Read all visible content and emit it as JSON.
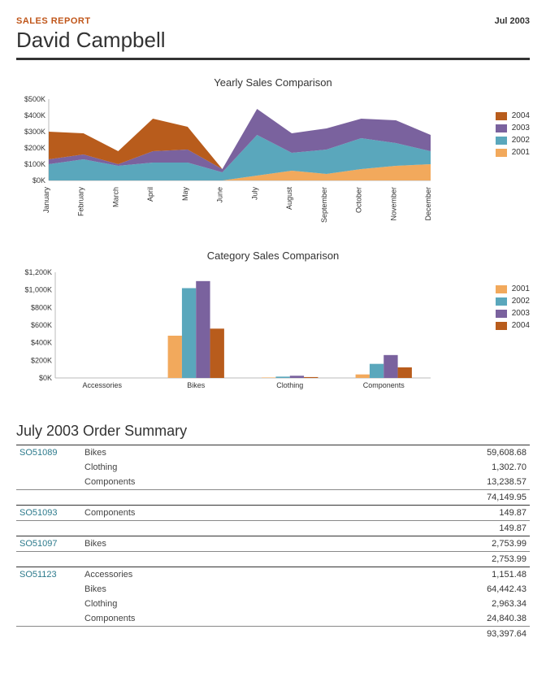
{
  "header": {
    "label": "SALES REPORT",
    "date": "Jul 2003",
    "name": "David Campbell"
  },
  "chart_data": [
    {
      "type": "area",
      "title": "Yearly Sales Comparison",
      "categories": [
        "January",
        "February",
        "March",
        "April",
        "May",
        "June",
        "July",
        "August",
        "September",
        "October",
        "November",
        "December"
      ],
      "ylim": [
        0,
        500
      ],
      "yticks": [
        "$0K",
        "$100K",
        "$200K",
        "$300K",
        "$400K",
        "$500K"
      ],
      "series": [
        {
          "name": "2001",
          "color": "#f2a95c",
          "values": [
            0,
            0,
            0,
            0,
            0,
            0,
            30,
            60,
            40,
            70,
            90,
            100
          ]
        },
        {
          "name": "2002",
          "color": "#5aa7bc",
          "values": [
            100,
            130,
            90,
            110,
            110,
            50,
            280,
            170,
            190,
            260,
            230,
            180
          ]
        },
        {
          "name": "2003",
          "color": "#7a629e",
          "values": [
            130,
            160,
            100,
            180,
            190,
            70,
            440,
            290,
            320,
            380,
            370,
            280
          ]
        },
        {
          "name": "2004",
          "color": "#b85c1c",
          "values": [
            300,
            290,
            180,
            380,
            330,
            70,
            440,
            290,
            320,
            380,
            370,
            280
          ]
        }
      ],
      "legend_order": [
        "2004",
        "2003",
        "2002",
        "2001"
      ]
    },
    {
      "type": "bar",
      "title": "Category Sales Comparison",
      "categories": [
        "Accessories",
        "Bikes",
        "Clothing",
        "Components"
      ],
      "ylim": [
        0,
        1200
      ],
      "yticks": [
        "$0K",
        "$200K",
        "$400K",
        "$600K",
        "$800K",
        "$1,000K",
        "$1,200K"
      ],
      "series": [
        {
          "name": "2001",
          "color": "#f2a95c",
          "values": [
            0,
            480,
            5,
            40
          ]
        },
        {
          "name": "2002",
          "color": "#5aa7bc",
          "values": [
            0,
            1020,
            15,
            160
          ]
        },
        {
          "name": "2003",
          "color": "#7a629e",
          "values": [
            0,
            1100,
            25,
            260
          ]
        },
        {
          "name": "2004",
          "color": "#b85c1c",
          "values": [
            0,
            560,
            10,
            120
          ]
        }
      ],
      "legend_order": [
        "2001",
        "2002",
        "2003",
        "2004"
      ]
    }
  ],
  "order_summary": {
    "title": "July 2003 Order Summary",
    "orders": [
      {
        "so": "SO51089",
        "lines": [
          {
            "cat": "Bikes",
            "amt": "59,608.68"
          },
          {
            "cat": "Clothing",
            "amt": "1,302.70"
          },
          {
            "cat": "Components",
            "amt": "13,238.57"
          }
        ],
        "total": "74,149.95"
      },
      {
        "so": "SO51093",
        "lines": [
          {
            "cat": "Components",
            "amt": "149.87"
          }
        ],
        "total": "149.87"
      },
      {
        "so": "SO51097",
        "lines": [
          {
            "cat": "Bikes",
            "amt": "2,753.99"
          }
        ],
        "total": "2,753.99"
      },
      {
        "so": "SO51123",
        "lines": [
          {
            "cat": "Accessories",
            "amt": "1,151.48"
          },
          {
            "cat": "Bikes",
            "amt": "64,442.43"
          },
          {
            "cat": "Clothing",
            "amt": "2,963.34"
          },
          {
            "cat": "Components",
            "amt": "24,840.38"
          }
        ],
        "total": "93,397.64"
      }
    ]
  }
}
